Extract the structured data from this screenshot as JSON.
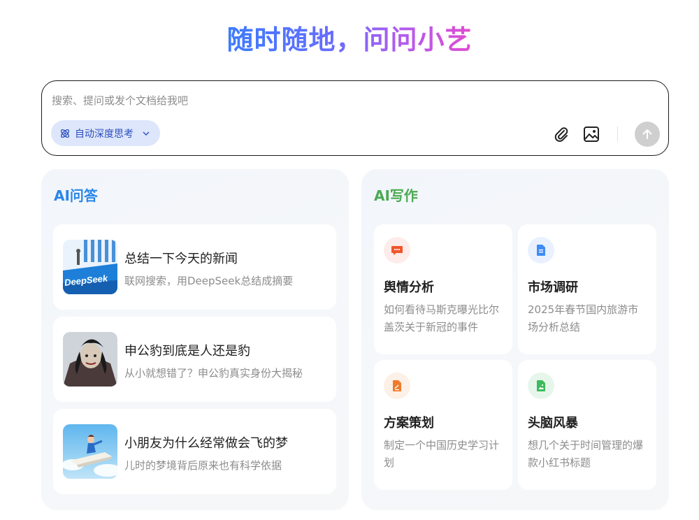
{
  "hero": {
    "title": "随时随地，问问小艺"
  },
  "input": {
    "placeholder": "搜索、提问或发个文档给我吧",
    "think_label": "自动深度思考",
    "attach_icon": "paperclip-icon",
    "image_icon": "image-icon",
    "send_icon": "arrow-up-icon"
  },
  "qa": {
    "title": "AI问答",
    "items": [
      {
        "title": "总结一下今天的新闻",
        "subtitle": "联网搜索，用DeepSeek总结成摘要",
        "thumb_text": "DeepSeek"
      },
      {
        "title": "申公豹到底是人还是豹",
        "subtitle": "从小就想错了？申公豹真实身份大揭秘"
      },
      {
        "title": "小朋友为什么经常做会飞的梦",
        "subtitle": "儿时的梦境背后原来也有科学依据"
      }
    ]
  },
  "writing": {
    "title": "AI写作",
    "items": [
      {
        "title": "舆情分析",
        "desc": "如何看待马斯克曝光比尔盖茨关于新冠的事件",
        "icon": "chat-icon",
        "color": "#f0552c",
        "bg": "#fdecea"
      },
      {
        "title": "市场调研",
        "desc": "2025年春节国内旅游市场分析总结",
        "icon": "document-icon",
        "color": "#3f8cf5",
        "bg": "#e8f1fd"
      },
      {
        "title": "方案策划",
        "desc": "制定一个中国历史学习计划",
        "icon": "pen-doc-icon",
        "color": "#f07a2c",
        "bg": "#fdf0e6"
      },
      {
        "title": "头脑风暴",
        "desc": "想几个关于时间管理的爆款小红书标题",
        "icon": "image-doc-icon",
        "color": "#3dbb5d",
        "bg": "#e7f6ea"
      }
    ]
  },
  "colors": {
    "qa_title": "#2a86e8",
    "writing_title": "#4caa52",
    "think_bg": "#dde6fb",
    "send_bg": "#cfcfcf"
  }
}
